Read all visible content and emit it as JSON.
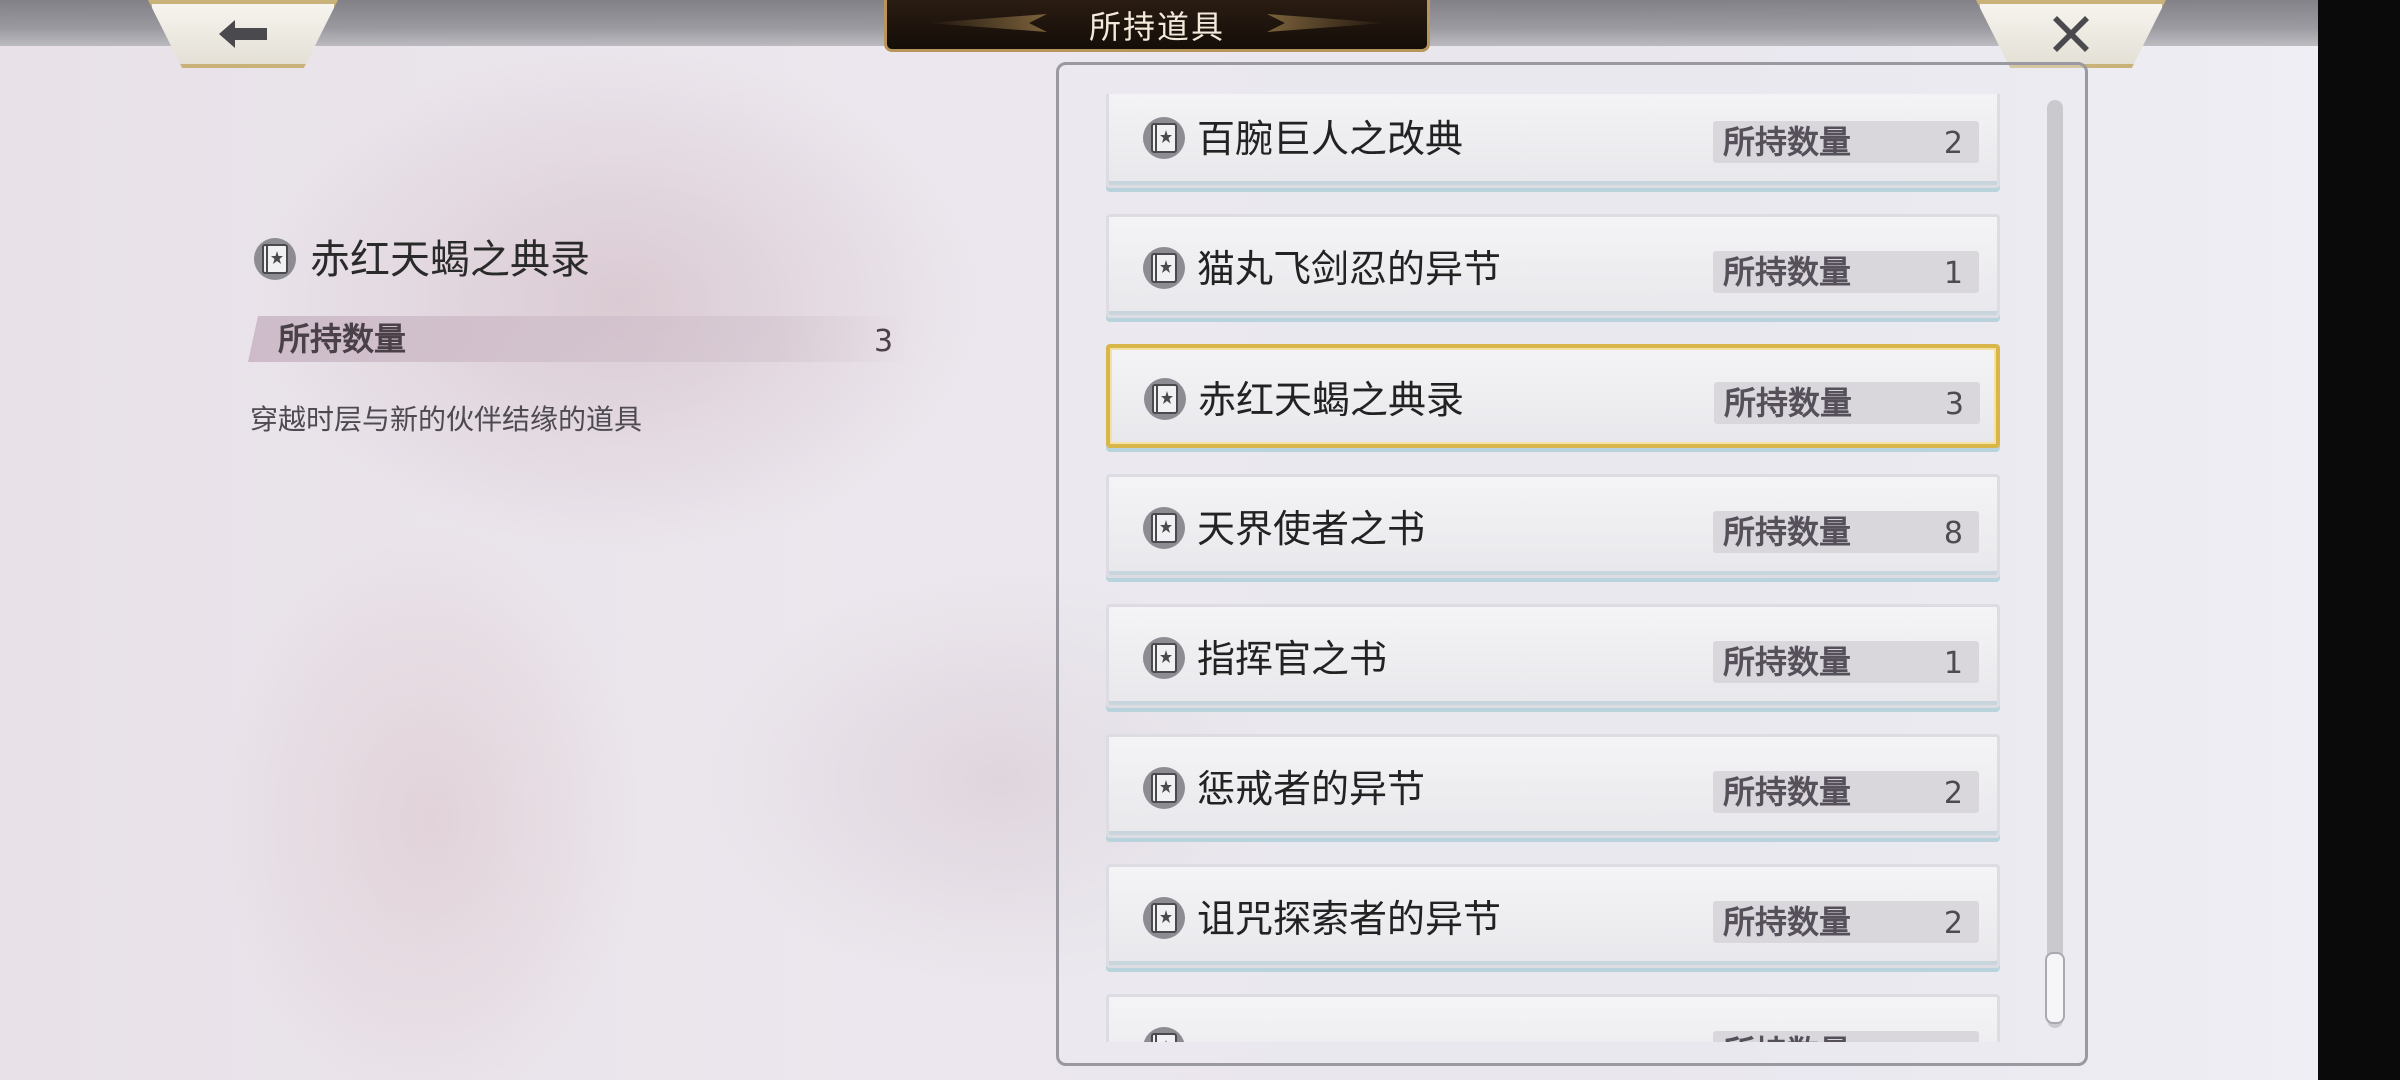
{
  "header": {
    "title": "所持道具",
    "back_icon": "arrow-left-icon",
    "close_icon": "close-x-icon"
  },
  "detail": {
    "name": "赤红天蝎之典录",
    "qty_label": "所持数量",
    "qty_value": "3",
    "description": "穿越时层与新的伙伴结缘的道具",
    "icon": "book-icon"
  },
  "items": [
    {
      "name": "百腕巨人之改典",
      "qty_label": "所持数量",
      "qty": "2"
    },
    {
      "name": "猫丸飞剑忍的异节",
      "qty_label": "所持数量",
      "qty": "1"
    },
    {
      "name": "赤红天蝎之典录",
      "qty_label": "所持数量",
      "qty": "3"
    },
    {
      "name": "天界使者之书",
      "qty_label": "所持数量",
      "qty": "8"
    },
    {
      "name": "指挥官之书",
      "qty_label": "所持数量",
      "qty": "1"
    },
    {
      "name": "惩戒者的异节",
      "qty_label": "所持数量",
      "qty": "2"
    },
    {
      "name": "诅咒探索者的异节",
      "qty_label": "所持数量",
      "qty": "2"
    },
    {
      "name": "",
      "qty_label": "所持数量",
      "qty": ""
    }
  ],
  "selected_index": 2,
  "colors": {
    "selected_border": "#d8b64a",
    "title_plate": "#1c130c",
    "frame_gold": "#c9b27a"
  }
}
